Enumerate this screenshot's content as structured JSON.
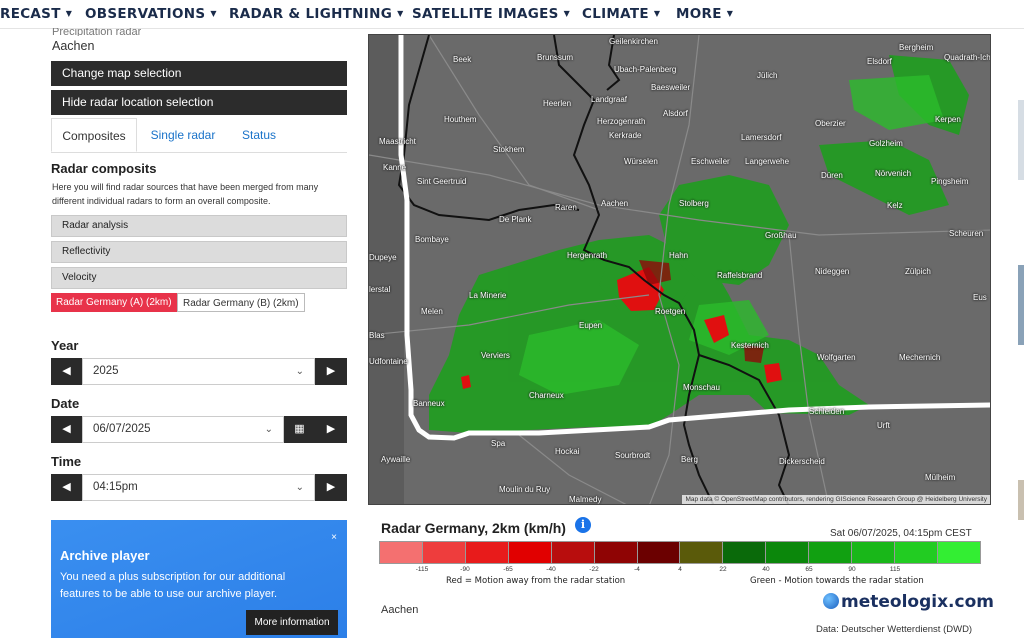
{
  "nav": {
    "items": [
      "RECAST",
      "OBSERVATIONS",
      "RADAR & LIGHTNING",
      "SATELLITE IMAGES",
      "CLIMATE",
      "MORE"
    ]
  },
  "location": {
    "subtitle": "Precipitation radar",
    "name": "Aachen"
  },
  "buttons": {
    "change_map": "Change map selection",
    "hide_radar": "Hide radar location selection"
  },
  "tabs": [
    "Composites",
    "Single radar",
    "Status"
  ],
  "composites": {
    "title": "Radar composits",
    "description": "Here you will find radar sources that have been merged from many different individual radars to form an overall composite.",
    "groups": [
      "Radar analysis",
      "Reflectivity",
      "Velocity"
    ],
    "products": [
      "Radar Germany (A) (2km)",
      "Radar Germany (B) (2km)"
    ]
  },
  "filters": {
    "year_label": "Year",
    "year": "2025",
    "date_label": "Date",
    "date": "06/07/2025",
    "time_label": "Time",
    "time": "04:15pm"
  },
  "archive": {
    "close": "×",
    "title": "Archive player",
    "text": "You need a plus subscription for our additional features to be able to use our archive player.",
    "more": "More information"
  },
  "map": {
    "places": [
      "Geilenkirchen",
      "Brunssum",
      "Ubach-Palenberg",
      "Jülich",
      "Bergheim",
      "Quadrath-Ichendorf",
      "Heerlen",
      "Landgraaf",
      "Baesweiler",
      "Elsdorf",
      "Houthem",
      "Herzogenrath",
      "Alsdorf",
      "Kerkrade",
      "Oberzier",
      "Kerpen",
      "Maastricht",
      "Stokhem",
      "Lamersdorf",
      "Golzheim",
      "Würselen",
      "Eschweiler",
      "Langerwehe",
      "Düren",
      "Nörvenich",
      "Pingsheim",
      "Sint Geertruid",
      "Aachen",
      "Stolberg",
      "Raren",
      "Kelz",
      "De Plank",
      "Großhau",
      "Scheuren",
      "Bombaye",
      "Hergenrath",
      "Hahn",
      "Raffelsbrand",
      "Nideggen",
      "Zülpich",
      "Dupeye",
      "La Minerie",
      "Melen",
      "Eupen",
      "Roetgen",
      "Kesternich",
      "Wolfgarten",
      "Mechernich",
      "Verviers",
      "Charneux",
      "Monschau",
      "Schleiden",
      "Banneux",
      "Urft",
      "Spa",
      "Hockai",
      "Sourbrodt",
      "Aywaille",
      "Dickerscheid",
      "Berg",
      "Moulin du Ruy",
      "Malmedy",
      "Mülheim",
      "Kanne",
      "lerstal",
      "Beek",
      "Eus",
      "Blas",
      "Udfontaine"
    ],
    "attribution": "Map data © OpenStreetMap contributors, rendering GIScience Research Group @ Heidelberg University"
  },
  "legend": {
    "title": "Radar Germany, 2km (km/h)",
    "info_icon": "i",
    "timestamp": "Sat 06/07/2025, 04:15pm CEST",
    "colors": [
      "#f47070",
      "#ee3d3d",
      "#e81b1b",
      "#e10000",
      "#b80d0d",
      "#8f0404",
      "#6b0000",
      "#5a5a0a",
      "#0a6a0a",
      "#0b870b",
      "#11a011",
      "#19b719",
      "#22cc22",
      "#33ee33"
    ],
    "ticks": [
      "-115",
      "-90",
      "-65",
      "-40",
      "-22",
      "-4",
      "4",
      "22",
      "40",
      "65",
      "90",
      "115"
    ],
    "away_note": "Red = Motion away from the radar station",
    "towards_note": "Green - Motion towards the radar station",
    "place": "Aachen",
    "brand": "meteologix.com",
    "source": "Data: Deutscher Wetterdienst (DWD)"
  }
}
